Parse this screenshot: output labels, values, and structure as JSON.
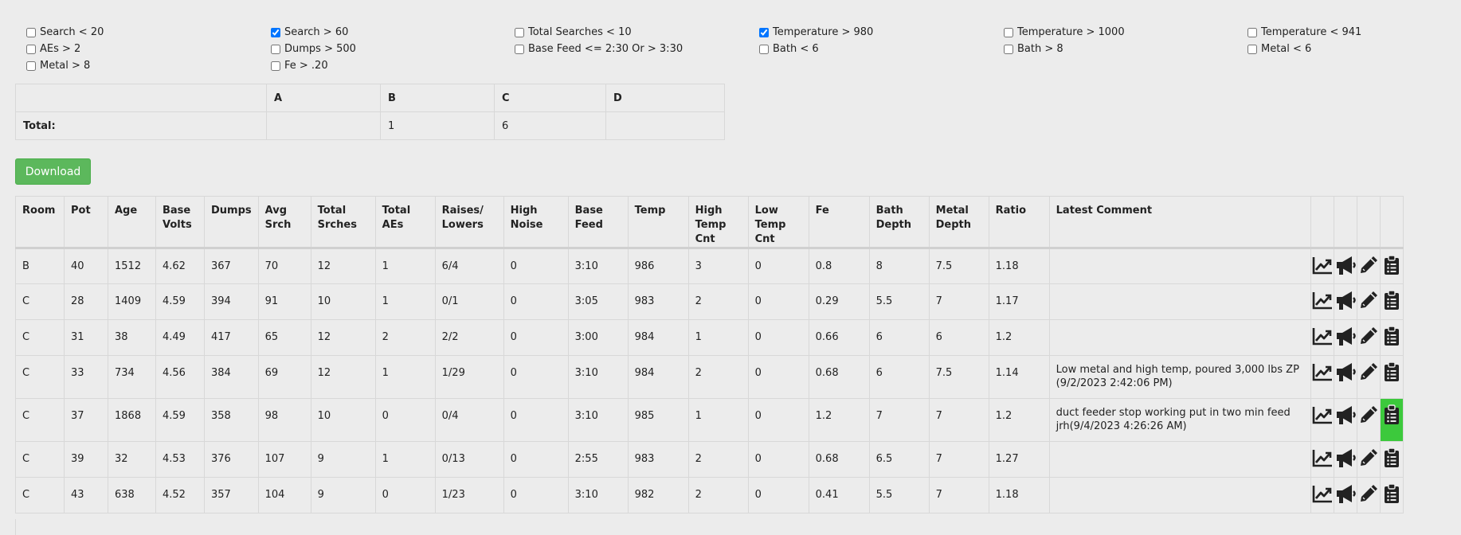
{
  "filters": [
    [
      {
        "label": "Search < 20",
        "checked": false
      },
      {
        "label": "AEs > 2",
        "checked": false
      },
      {
        "label": "Metal > 8",
        "checked": false
      }
    ],
    [
      {
        "label": "Search > 60",
        "checked": true
      },
      {
        "label": "Dumps > 500",
        "checked": false
      },
      {
        "label": "Fe > .20",
        "checked": false
      }
    ],
    [
      {
        "label": "Total Searches < 10",
        "checked": false
      },
      {
        "label": "Base Feed <= 2:30 Or > 3:30",
        "checked": false
      }
    ],
    [
      {
        "label": "Temperature > 980",
        "checked": true
      },
      {
        "label": "Bath < 6",
        "checked": false
      }
    ],
    [
      {
        "label": "Temperature > 1000",
        "checked": false
      },
      {
        "label": "Bath > 8",
        "checked": false
      }
    ],
    [
      {
        "label": "Temperature < 941",
        "checked": false
      },
      {
        "label": "Metal < 6",
        "checked": false
      }
    ]
  ],
  "summary": {
    "headers": [
      "",
      "A",
      "B",
      "C",
      "D"
    ],
    "total_label": "Total:",
    "totals": [
      "",
      "1",
      "6",
      ""
    ]
  },
  "download_label": "Download",
  "columns": [
    "Room",
    "Pot",
    "Age",
    "Base Volts",
    "Dumps",
    "Avg Srch",
    "Total Srches",
    "Total AEs",
    "Raises/ Lowers",
    "High Noise",
    "Base Feed",
    "Temp",
    "High Temp Cnt",
    "Low Temp Cnt",
    "Fe",
    "Bath Depth",
    "Metal Depth",
    "Ratio",
    "Latest Comment"
  ],
  "rows": [
    {
      "cells": [
        "B",
        "40",
        "1512",
        "4.62",
        "367",
        "70",
        "12",
        "1",
        "6/4",
        "0",
        "3:10",
        "986",
        "3",
        "0",
        "0.8",
        "8",
        "7.5",
        "1.18",
        ""
      ],
      "highlight": false
    },
    {
      "cells": [
        "C",
        "28",
        "1409",
        "4.59",
        "394",
        "91",
        "10",
        "1",
        "0/1",
        "0",
        "3:05",
        "983",
        "2",
        "0",
        "0.29",
        "5.5",
        "7",
        "1.17",
        ""
      ],
      "highlight": false
    },
    {
      "cells": [
        "C",
        "31",
        "38",
        "4.49",
        "417",
        "65",
        "12",
        "2",
        "2/2",
        "0",
        "3:00",
        "984",
        "1",
        "0",
        "0.66",
        "6",
        "6",
        "1.2",
        ""
      ],
      "highlight": false
    },
    {
      "cells": [
        "C",
        "33",
        "734",
        "4.56",
        "384",
        "69",
        "12",
        "1",
        "1/29",
        "0",
        "3:10",
        "984",
        "2",
        "0",
        "0.68",
        "6",
        "7.5",
        "1.14",
        "Low metal and high temp, poured 3,000 lbs ZP (9/2/2023 2:42:06 PM)"
      ],
      "highlight": false
    },
    {
      "cells": [
        "C",
        "37",
        "1868",
        "4.59",
        "358",
        "98",
        "10",
        "0",
        "0/4",
        "0",
        "3:10",
        "985",
        "1",
        "0",
        "1.2",
        "7",
        "7",
        "1.2",
        "duct feeder stop working put in two min feed jrh(9/4/2023 4:26:26 AM)"
      ],
      "highlight": true
    },
    {
      "cells": [
        "C",
        "39",
        "32",
        "4.53",
        "376",
        "107",
        "9",
        "1",
        "0/13",
        "0",
        "2:55",
        "983",
        "2",
        "0",
        "0.68",
        "6.5",
        "7",
        "1.27",
        ""
      ],
      "highlight": false
    },
    {
      "cells": [
        "C",
        "43",
        "638",
        "4.52",
        "357",
        "104",
        "9",
        "0",
        "1/23",
        "0",
        "3:10",
        "982",
        "2",
        "0",
        "0.41",
        "5.5",
        "7",
        "1.18",
        ""
      ],
      "highlight": false
    }
  ],
  "icons": [
    "chart-icon",
    "megaphone-icon",
    "pencil-icon",
    "clipboard-icon"
  ],
  "colors": {
    "download": "#5cb85c",
    "highlight": "#3cc93c"
  }
}
